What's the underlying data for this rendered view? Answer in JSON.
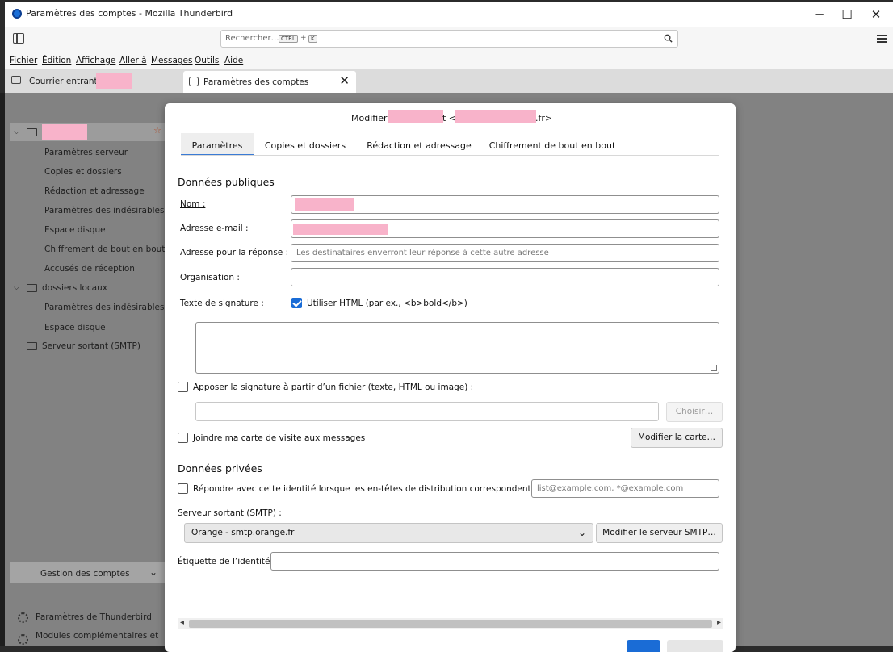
{
  "window": {
    "title": "Paramètres des comptes - Mozilla Thunderbird",
    "controls": {
      "minimize": "─",
      "maximize": "☐",
      "close": "✕"
    }
  },
  "toolbar": {
    "search_placeholder": "Rechercher…",
    "shortcut_key1": "CTRL",
    "shortcut_plus": "+",
    "shortcut_key2": "K"
  },
  "menubar": [
    "Fichier",
    "Édition",
    "Affichage",
    "Aller à",
    "Messages",
    "Outils",
    "Aide"
  ],
  "tabs": {
    "inbox_label": "Courrier entrant -",
    "accounts_label": "Paramètres des comptes",
    "close_glyph": "✕"
  },
  "sidebar": {
    "account_items": [
      "Paramètres serveur",
      "Copies et dossiers",
      "Rédaction et adressage",
      "Paramètres des indésirables",
      "Espace disque",
      "Chiffrement de bout en bout",
      "Accusés de réception"
    ],
    "local_folders_label": "dossiers locaux",
    "local_items": [
      "Paramètres des indésirables",
      "Espace disque"
    ],
    "smtp_label": "Serveur sortant (SMTP)",
    "account_actions_label": "Gestion des comptes",
    "footer": [
      "Paramètres de Thunderbird",
      "Modules complémentaires et"
    ]
  },
  "dialog": {
    "title_prefix": "Modifier",
    "title_mid": "t <",
    "title_suffix": ".fr>",
    "tabs": [
      "Paramètres",
      "Copies et dossiers",
      "Rédaction et adressage",
      "Chiffrement de bout en bout"
    ],
    "public_heading": "Données publiques",
    "name_label": "Nom :",
    "email_label": "Adresse e-mail :",
    "reply_label": "Adresse pour la réponse :",
    "reply_placeholder": "Les destinataires enverront leur réponse à cette autre adresse",
    "org_label": "Organisation :",
    "sig_label": "Texte de signature :",
    "use_html_label": "Utiliser HTML (par ex., <b>bold</b>)",
    "attach_sig_label": "Apposer la signature à partir d’un fichier (texte, HTML ou image) :",
    "choose_button": "Choisir…",
    "vcard_label": "Joindre ma carte de visite aux messages",
    "edit_card_button": "Modifier la carte…",
    "private_heading": "Données privées",
    "reply_identity_label": "Répondre avec cette identité lorsque les en-têtes de distribution correspondent à :",
    "reply_identity_placeholder": "list@example.com, *@example.com",
    "smtp_label": "Serveur sortant (SMTP) :",
    "smtp_value": "Orange - smtp.orange.fr",
    "edit_smtp_button": "Modifier le serveur SMTP…",
    "identity_label": "Étiquette de l’identité :"
  },
  "colors": {
    "accent": "#1a6cd6",
    "redaction_mask": "#f8b3ca"
  },
  "icons": [
    "thunderbird-logo-icon",
    "sidebar-toggle-icon",
    "search-icon",
    "app-menu-icon",
    "mail-icon",
    "gear-icon",
    "folder-icon",
    "server-icon",
    "star-icon",
    "chevron-down-icon",
    "checkmark-icon",
    "resize-grip-icon"
  ]
}
